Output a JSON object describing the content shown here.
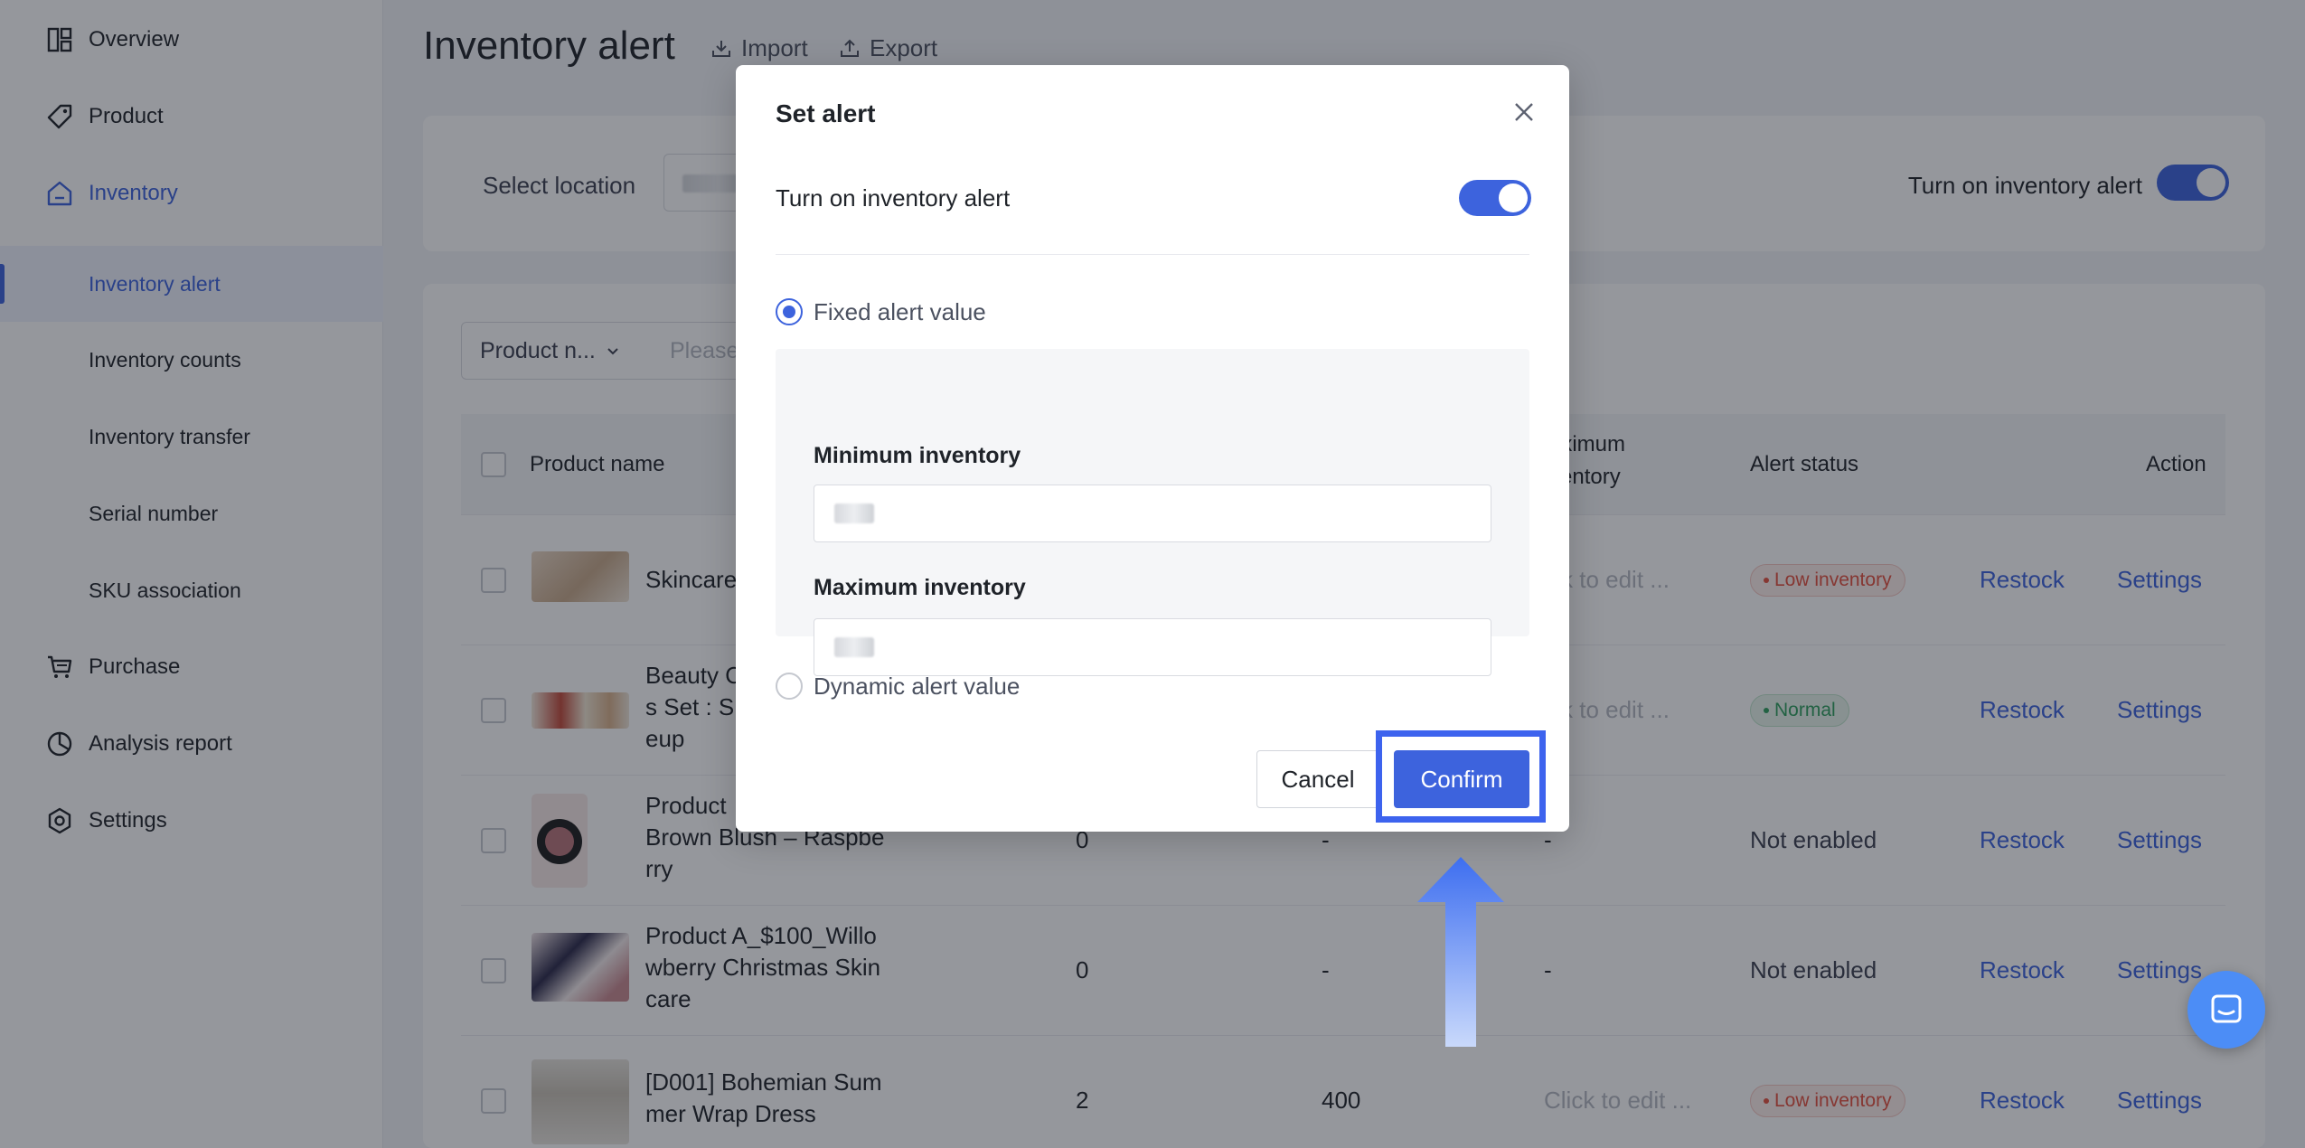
{
  "sidebar": {
    "items": [
      {
        "label": "Overview",
        "icon": "overview-icon"
      },
      {
        "label": "Product",
        "icon": "tag-icon"
      },
      {
        "label": "Inventory",
        "icon": "home-icon"
      },
      {
        "label": "Purchase",
        "icon": "cart-icon"
      },
      {
        "label": "Analysis report",
        "icon": "pie-chart-icon"
      },
      {
        "label": "Settings",
        "icon": "gear-icon"
      }
    ],
    "sub_items": [
      {
        "label": "Inventory alert",
        "active": true
      },
      {
        "label": "Inventory counts"
      },
      {
        "label": "Inventory transfer"
      },
      {
        "label": "Serial number"
      },
      {
        "label": "SKU association"
      }
    ]
  },
  "header": {
    "title": "Inventory alert",
    "import_label": "Import",
    "export_label": "Export"
  },
  "location_bar": {
    "label": "Select location",
    "toggle_label": "Turn on inventory alert",
    "toggle_on": true
  },
  "filters": {
    "field_select": "Product n...",
    "search_placeholder": "Please"
  },
  "table": {
    "headers": {
      "product_name": "Product name",
      "maximum_inventory_line1": "aximum",
      "maximum_inventory_line2": "ventory",
      "alert_status": "Alert status",
      "action": "Action"
    },
    "rows": [
      {
        "name": "Skincare",
        "c1": "",
        "c2": "",
        "c3": "ck to edit ...",
        "status": "Low inventory",
        "status_type": "low",
        "restock": "Restock",
        "settings": "Settings"
      },
      {
        "name": "Beauty C\ns Set : S\neup",
        "c1": "",
        "c2": "",
        "c3": "ck to edit ...",
        "status": "Normal",
        "status_type": "normal",
        "restock": "Restock",
        "settings": "Settings"
      },
      {
        "name": "Product\nBrown Blush – Raspbe\nrry",
        "c1": "0",
        "c2": "-",
        "c3": "-",
        "status": "Not enabled",
        "status_type": "none",
        "restock": "Restock",
        "settings": "Settings"
      },
      {
        "name": "Product A_$100_Willo\nwberry Christmas Skin\ncare",
        "c1": "0",
        "c2": "-",
        "c3": "-",
        "status": "Not enabled",
        "status_type": "none",
        "restock": "Restock",
        "settings": "Settings"
      },
      {
        "name": "[D001] Bohemian Sum\nmer Wrap Dress",
        "c1": "2",
        "c2": "400",
        "c3": "Click to edit ...",
        "status": "Low inventory",
        "status_type": "low",
        "restock": "Restock",
        "settings": "Settings"
      }
    ]
  },
  "modal": {
    "title": "Set alert",
    "toggle_label": "Turn on inventory alert",
    "toggle_on": true,
    "fixed_label": "Fixed alert value",
    "fixed_selected": true,
    "min_label": "Minimum inventory",
    "max_label": "Maximum inventory",
    "dynamic_label": "Dynamic alert value",
    "cancel_label": "Cancel",
    "confirm_label": "Confirm"
  },
  "colors": {
    "accent": "#3d63dd",
    "highlight": "#3d63ee"
  }
}
